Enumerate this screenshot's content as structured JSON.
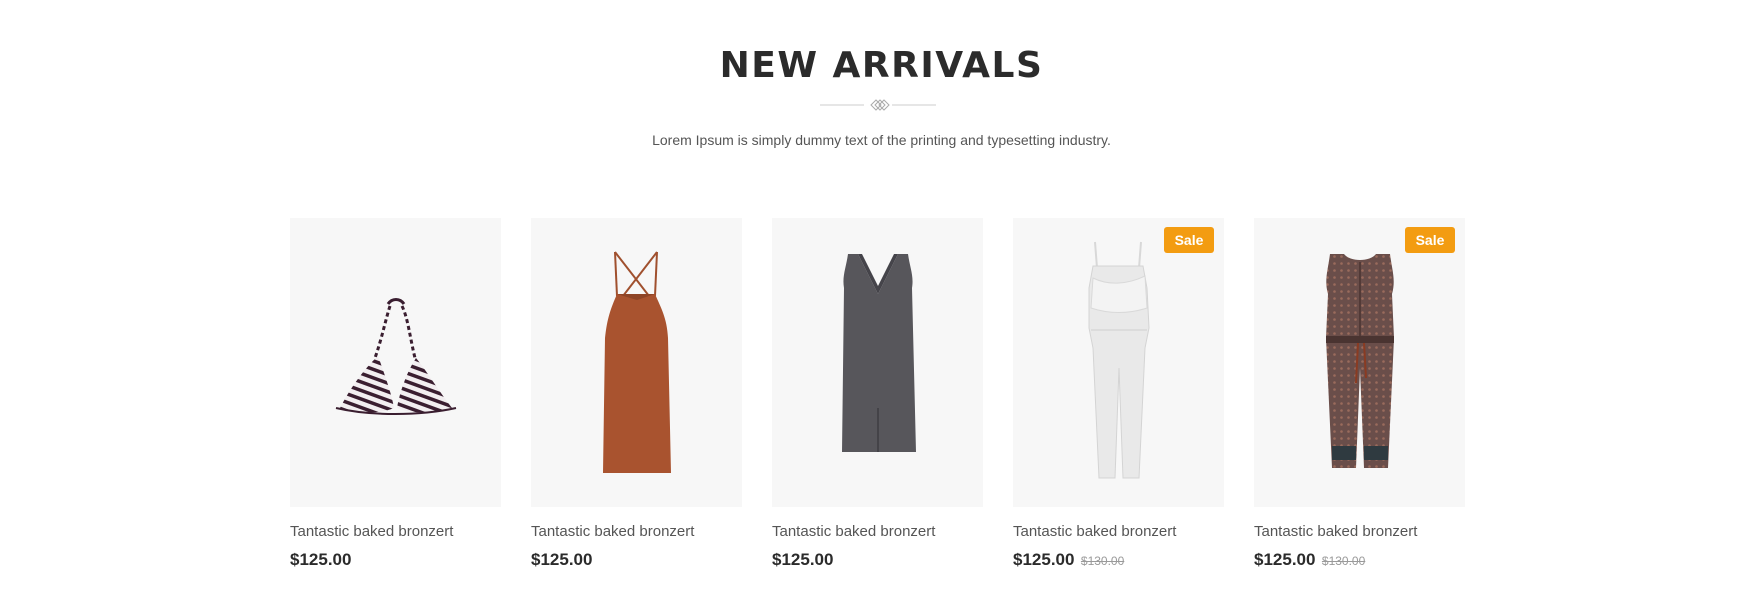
{
  "section": {
    "title": "NEW ARRIVALS",
    "subtitle": "Lorem Ipsum is simply dummy text of the printing and typesetting industry."
  },
  "colors": {
    "sale_badge": "#f39c11",
    "image_background": "#f7f7f7",
    "title": "#2b2b2b"
  },
  "products": [
    {
      "name": "Tantastic baked bronzert",
      "price": "$125.00",
      "old_price": "",
      "badge": "",
      "image_icon": "bikini-top-icon"
    },
    {
      "name": "Tantastic baked bronzert",
      "price": "$125.00",
      "old_price": "",
      "badge": "",
      "image_icon": "rust-slip-dress-icon"
    },
    {
      "name": "Tantastic baked bronzert",
      "price": "$125.00",
      "old_price": "",
      "badge": "",
      "image_icon": "grey-v-neck-dress-icon"
    },
    {
      "name": "Tantastic baked bronzert",
      "price": "$125.00",
      "old_price": "$130.00",
      "badge": "Sale",
      "image_icon": "white-jumpsuit-icon"
    },
    {
      "name": "Tantastic baked bronzert",
      "price": "$125.00",
      "old_price": "$130.00",
      "badge": "Sale",
      "image_icon": "patterned-jumpsuit-icon"
    }
  ]
}
